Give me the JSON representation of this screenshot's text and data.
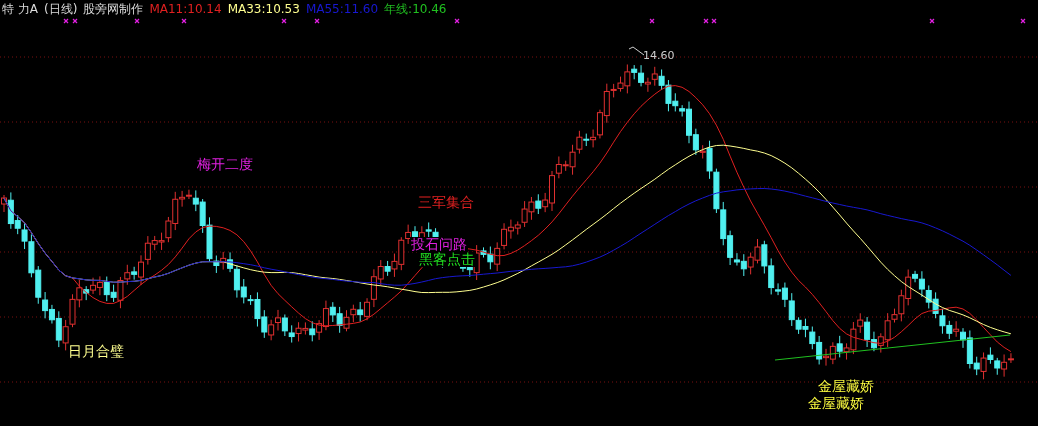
{
  "header": {
    "title": "特 力A",
    "period": "(日线)",
    "credit": "股旁网制作",
    "indicators": [
      {
        "text": "MA11:10.14",
        "color": "#e02020"
      },
      {
        "text": "MA33:10.53",
        "color": "#ffff90"
      },
      {
        "text": "MA55:11.60",
        "color": "#1818d0"
      },
      {
        "text": "年线:10.46",
        "color": "#20c020"
      }
    ]
  },
  "chart": {
    "high_label": "14.60",
    "signals": [
      {
        "text": "梅开二度",
        "color": "#e020e0"
      },
      {
        "text": "三军集合",
        "color": "#e02020"
      },
      {
        "text": "投石问路",
        "color": "#e020e0"
      },
      {
        "text": "黑客点击",
        "color": "#20e020"
      },
      {
        "text": "日月合璧",
        "color": "#ffff90"
      },
      {
        "text": "金屋藏娇",
        "color": "#ffff40"
      },
      {
        "text": "金屋藏娇",
        "color": "#ffff40"
      }
    ]
  }
}
